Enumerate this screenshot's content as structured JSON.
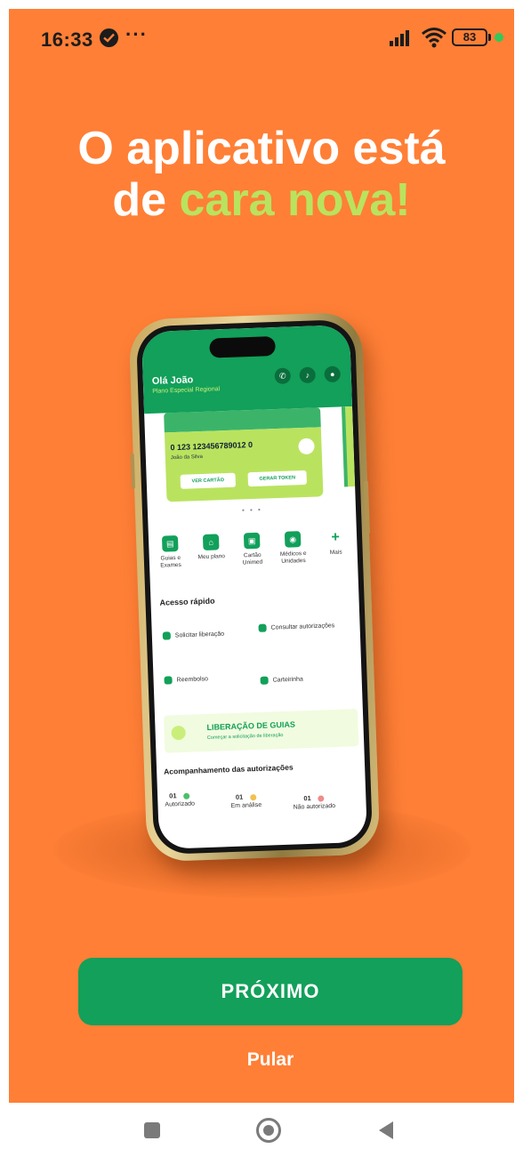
{
  "status_bar": {
    "time": "16:33",
    "overflow": "···",
    "battery": "83",
    "icons": [
      "check-circle-icon",
      "signal-icon",
      "wifi-icon",
      "battery-icon",
      "charging-dot-icon"
    ]
  },
  "headline": {
    "line1": "O aplicativo está",
    "line2_prefix": "de",
    "line2_accent": "cara nova!"
  },
  "mockup": {
    "greeting": "Olá João",
    "plan": "Plano Especial Regional",
    "header_icons": [
      "phone-icon",
      "bell-icon",
      "profile-icon"
    ],
    "card": {
      "number": "0 123 123456789012 0",
      "holder": "João da Silva",
      "view_button": "VER CARTÃO",
      "token_button": "GERAR TOKEN"
    },
    "pager": "• • •",
    "shortcuts": [
      {
        "label": "Guias e Exames",
        "icon": "document-icon"
      },
      {
        "label": "Meu plano",
        "icon": "plan-icon"
      },
      {
        "label": "Cartão Unimed",
        "icon": "card-icon"
      },
      {
        "label": "Médicos e Unidades",
        "icon": "location-icon"
      },
      {
        "label": "Mais",
        "icon": "plus-icon"
      }
    ],
    "quick_access_title": "Acesso rápido",
    "quick_access": [
      {
        "label": "Solicitar liberação"
      },
      {
        "label": "Consultar autorizações"
      },
      {
        "label": "Reembolso"
      },
      {
        "label": "Carteirinha"
      }
    ],
    "banner": {
      "title": "LIBERAÇÃO DE GUIAS",
      "subtitle": "Começar a solicitação de liberação"
    },
    "tracking_title": "Acompanhamento das autorizações",
    "tracking": [
      {
        "count": "01",
        "label": "Autorizado",
        "color": "#4cbf6a"
      },
      {
        "count": "01",
        "label": "Em análise",
        "color": "#f2c14e"
      },
      {
        "count": "01",
        "label": "Não autorizado",
        "color": "#f08a8a"
      }
    ]
  },
  "actions": {
    "next": "PRÓXIMO",
    "skip": "Pular"
  },
  "nav_bar": {
    "icons": [
      "recents-icon",
      "home-icon",
      "back-icon"
    ]
  },
  "colors": {
    "background": "#ff7f36",
    "primary": "#12a05a",
    "accent": "#b9e35f",
    "text_on_primary": "#ffffff"
  }
}
